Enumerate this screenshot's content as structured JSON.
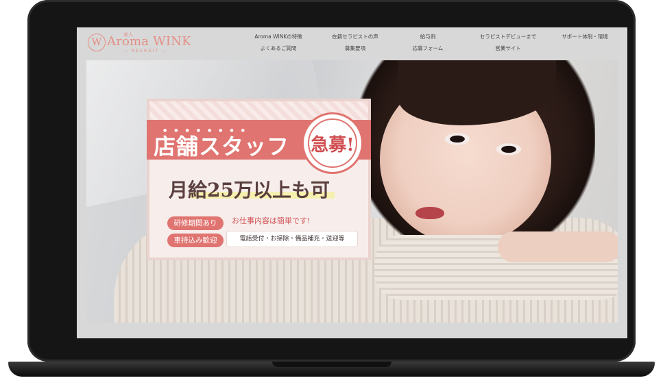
{
  "logo": {
    "small": "求人",
    "text": "Aroma WINK",
    "sub": "— RECRUIT —",
    "mark": "W"
  },
  "nav": {
    "row1": [
      "Aroma WINKの特徴",
      "在籍セラピストの声",
      "給与例",
      "セラピストデビューまで",
      "サポート体制・環境"
    ],
    "row2": [
      "よくあるご質問",
      "募集要項",
      "応募フォーム",
      "営業サイト"
    ]
  },
  "hero": {
    "title": "店舗スタッフ",
    "badge": "急募!",
    "salary": "月給25万以上も可",
    "pills": [
      "研修期間あり",
      "車持込み歓迎"
    ],
    "info_title": "お仕事内容は簡単です!",
    "info_text": "電話受付・お掃除・備品補充・送迎等"
  },
  "colors": {
    "accent": "#e07470",
    "logo": "#e48f86"
  }
}
